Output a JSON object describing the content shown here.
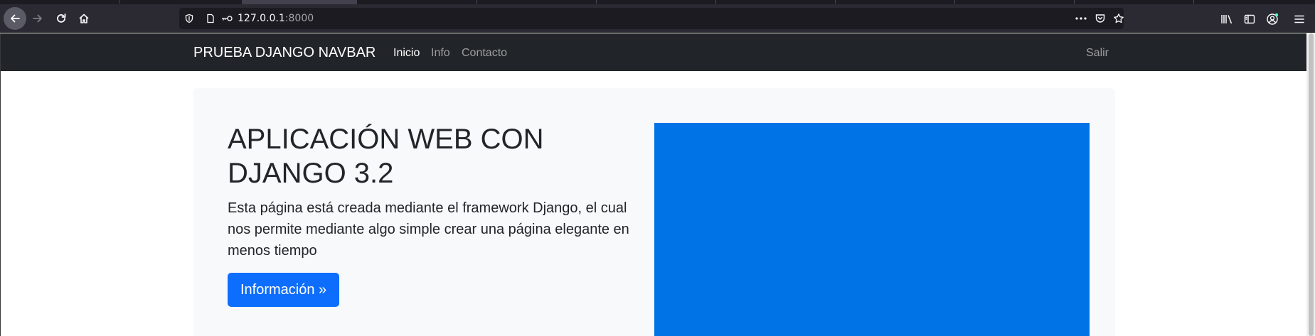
{
  "browser": {
    "url_host": "127.0.0.1",
    "url_port": ":8000"
  },
  "navbar": {
    "brand": "PRUEBA DJANGO NAVBAR",
    "links": [
      "Inicio",
      "Info",
      "Contacto"
    ],
    "logout": "Salir"
  },
  "hero": {
    "title": "APLICACIÓN WEB CON DJANGO 3.2",
    "lead": "Esta página está creada mediante el framework Django, el cual nos permite mediante algo simple crear una página elegante en menos tiempo",
    "button": "Información »",
    "image_color": "#0073e6"
  },
  "colors": {
    "navbar_bg": "#212529",
    "primary": "#0d6efd",
    "jumbotron_bg": "#f8f9fa"
  }
}
